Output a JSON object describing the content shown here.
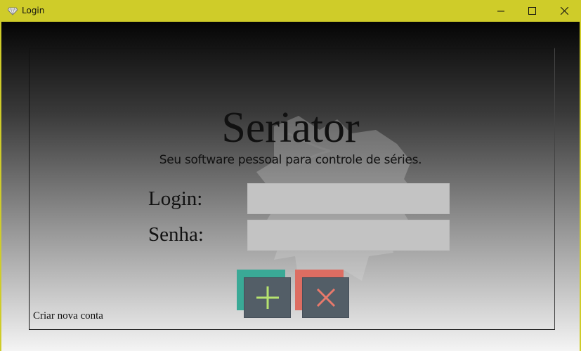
{
  "window": {
    "title": "Login",
    "icon": "app-gem-icon",
    "accent": "#cfcc29"
  },
  "controls": {
    "minimize": "minimize-icon",
    "maximize": "maximize-icon",
    "close": "close-icon"
  },
  "app": {
    "title": "Seriator",
    "subtitle": "Seu software pessoal para controle de séries."
  },
  "form": {
    "login_label": "Login:",
    "password_label": "Senha:",
    "login_value": "",
    "password_value": ""
  },
  "buttons": {
    "add_icon": "plus-icon",
    "add_color": "#3aa996",
    "cancel_icon": "x-icon",
    "cancel_color": "#dd6d62"
  },
  "links": {
    "create_account": "Criar nova conta"
  }
}
